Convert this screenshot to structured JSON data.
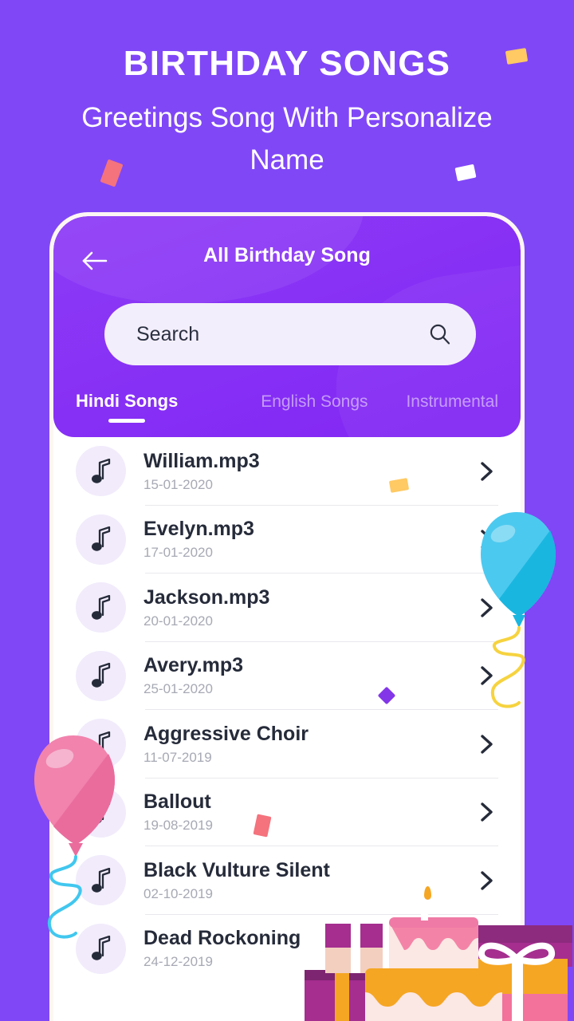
{
  "promo": {
    "title": "BIRTHDAY SONGS",
    "subtitle": "Greetings Song With Personalize Name"
  },
  "colors": {
    "background": "#8047f7",
    "header": "#8b33f5",
    "search_bg": "#f3eefb",
    "accent_white": "#ffffff",
    "note_circle": "#f1ebfb",
    "song_title": "#262b3a",
    "song_date": "#a7a9b4",
    "balloon_blue": "#3ec5ea",
    "balloon_pink": "#ef7aa5",
    "confetti_yellow": "#ffc963",
    "confetti_red": "#f4737d",
    "confetti_purple": "#8236e8"
  },
  "app": {
    "title": "All Birthday Song",
    "back_icon": "arrow-left-icon",
    "search": {
      "placeholder": "Search",
      "value": "",
      "icon": "search-icon"
    },
    "tabs": [
      {
        "label": "Hindi Songs",
        "active": true
      },
      {
        "label": "English Songs",
        "active": false
      },
      {
        "label": "Instrumental",
        "active": false
      }
    ],
    "list_chevron_icon": "chevron-right-icon",
    "row_icon": "music-note-icon",
    "songs": [
      {
        "name": "William.mp3",
        "date": "15-01-2020"
      },
      {
        "name": "Evelyn.mp3",
        "date": "17-01-2020"
      },
      {
        "name": "Jackson.mp3",
        "date": "20-01-2020"
      },
      {
        "name": "Avery.mp3",
        "date": "25-01-2020"
      },
      {
        "name": "Aggressive Choir",
        "date": "11-07-2019"
      },
      {
        "name": "Ballout",
        "date": "19-08-2019"
      },
      {
        "name": "Black Vulture Silent",
        "date": "02-10-2019"
      },
      {
        "name": "Dead Rockoning",
        "date": "24-12-2019"
      }
    ]
  },
  "decorations": {
    "balloon_blue": "balloon-icon",
    "balloon_pink": "balloon-icon",
    "cake": "birthday-cake-icon",
    "gifts": "gift-box-icon",
    "confetti": [
      "confetti-yellow",
      "confetti-red",
      "confetti-white",
      "confetti-purple"
    ]
  }
}
